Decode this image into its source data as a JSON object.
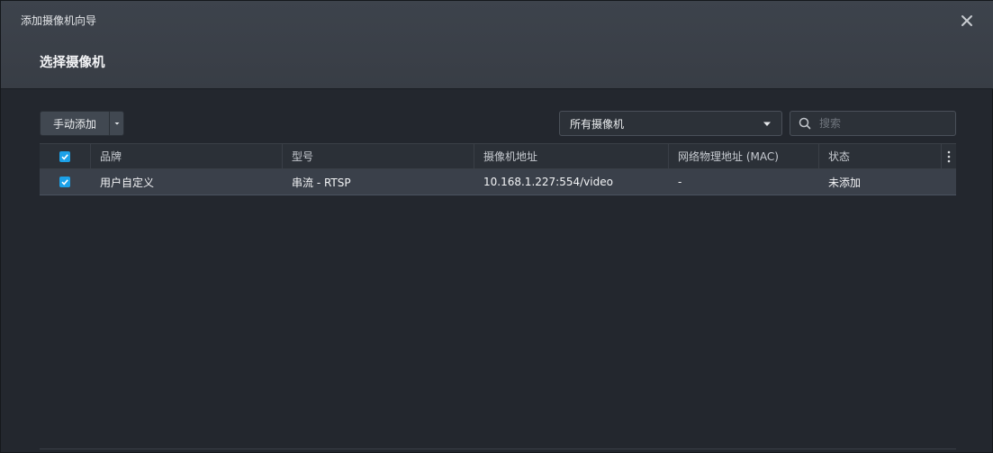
{
  "dialog": {
    "title": "添加摄像机向导",
    "step_title": "选择摄像机"
  },
  "toolbar": {
    "manual_add_label": "手动添加",
    "filter_value": "所有摄像机",
    "search_placeholder": "搜索"
  },
  "table": {
    "columns": [
      "品牌",
      "型号",
      "摄像机地址",
      "网络物理地址 (MAC)",
      "状态"
    ],
    "rows": [
      {
        "checked": true,
        "brand": "用户自定义",
        "model": "串流 - RTSP",
        "address": "10.168.1.227:554/video",
        "mac": "-",
        "status": "未添加"
      }
    ],
    "select_all_checked": true
  },
  "colors": {
    "accent": "#1ca1e8",
    "background": "#23272e",
    "header_bg": "#3c424b",
    "selected_row": "#3a404a"
  },
  "icons": [
    "close-icon",
    "caret-down-icon",
    "search-icon",
    "checkbox-checked-icon",
    "more-vertical-icon"
  ]
}
